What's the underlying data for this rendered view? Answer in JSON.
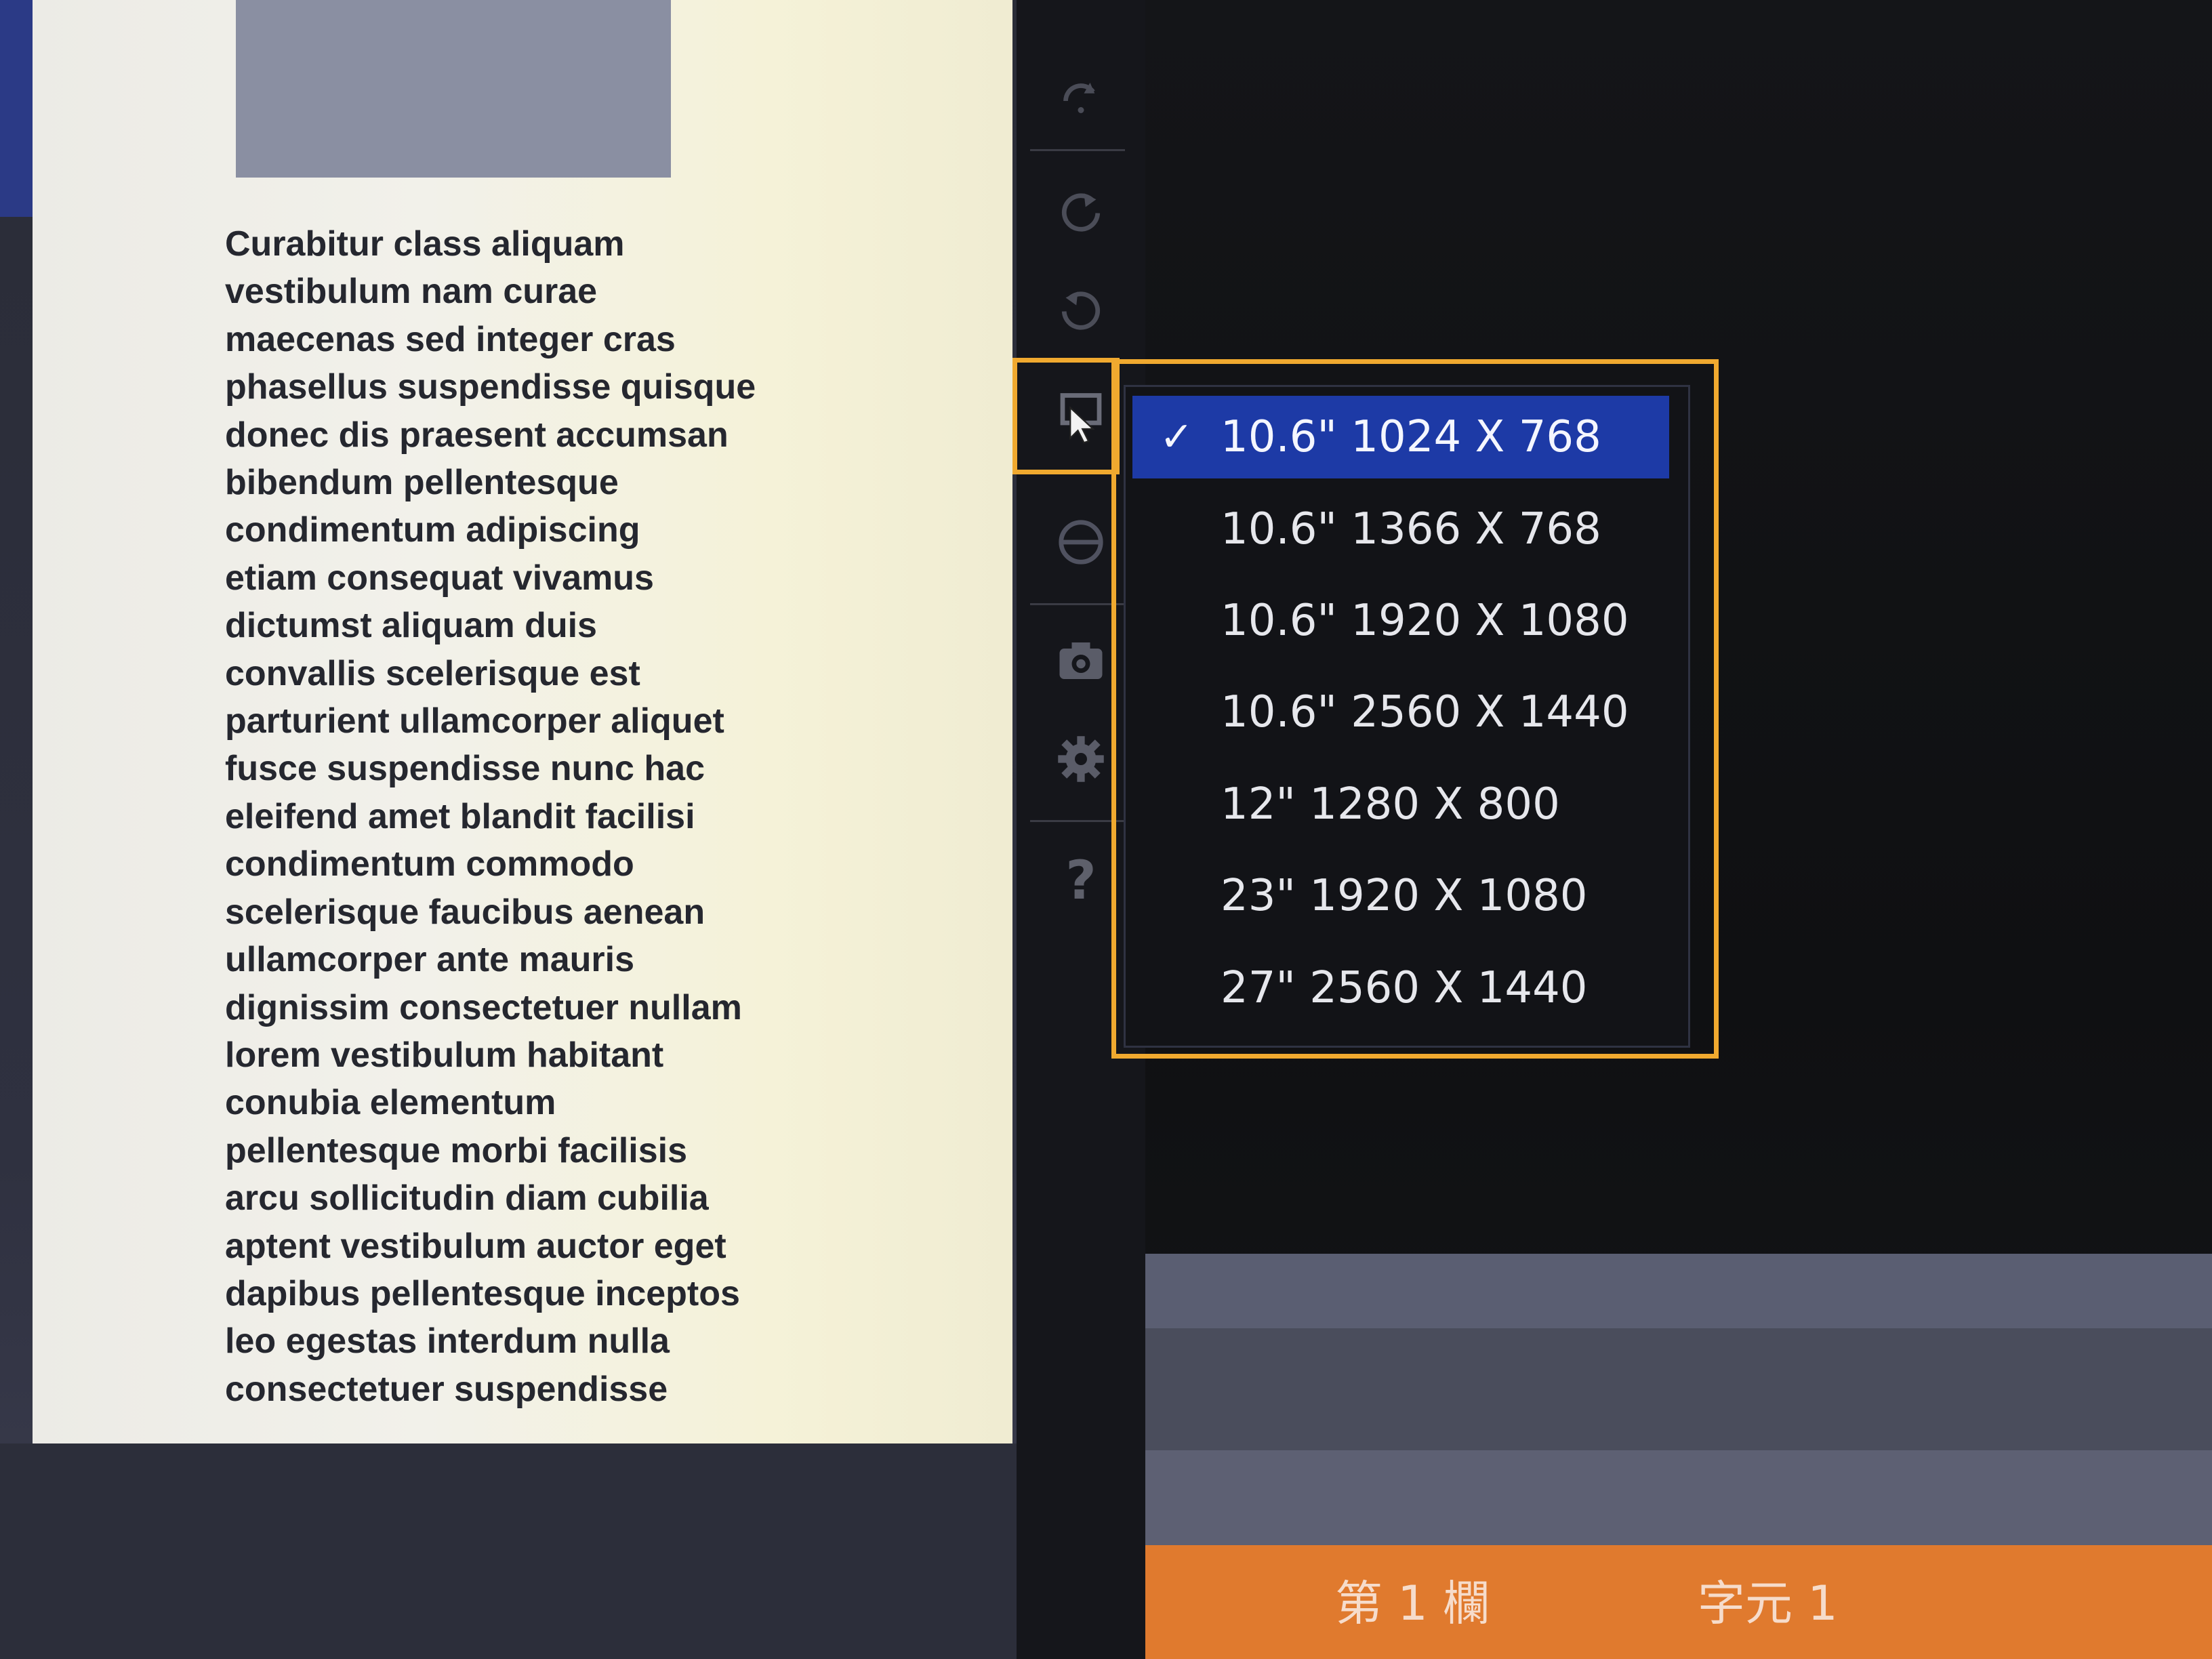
{
  "document": {
    "paragraph": "Curabitur class aliquam\nvestibulum nam curae\nmaecenas sed integer cras\nphasellus suspendisse quisque\ndonec dis praesent accumsan\nbibendum pellentesque\ncondimentum adipiscing\netiam consequat vivamus\ndictumst aliquam duis\nconvallis scelerisque est\nparturient ullamcorper aliquet\nfusce suspendisse nunc hac\neleifend amet blandit facilisi\ncondimentum commodo\nscelerisque faucibus aenean\nullamcorper ante mauris\ndignissim consectetuer nullam\nlorem vestibulum habitant\nconubia elementum\npellentesque morbi facilisis\narcu sollicitudin diam cubilia\naptent vestibulum auctor eget\ndapibus pellentesque inceptos\nleo egestas interdum nulla\nconsectetuer suspendisse"
  },
  "toolbar": {
    "icons": [
      "redo-icon",
      "rotate-right-icon",
      "rotate-left-icon",
      "device-size-icon",
      "globe-icon",
      "camera-icon",
      "gear-icon",
      "help-icon"
    ],
    "help_label": "?"
  },
  "device_menu": {
    "checkmark": "✓",
    "selected_index": 0,
    "items": [
      "10.6\" 1024 X 768",
      "10.6\" 1366 X 768",
      "10.6\" 1920 X 1080",
      "10.6\" 2560 X 1440",
      "12\" 1280 X 800",
      "23\" 1920 X 1080",
      "27\" 2560 X 1440"
    ]
  },
  "status_bar": {
    "column": "第 1 欄",
    "char": "字元 1"
  },
  "colors": {
    "highlight": "#f0a92f",
    "selected": "#1d3aa6",
    "status_bar": "#e07a2e"
  }
}
